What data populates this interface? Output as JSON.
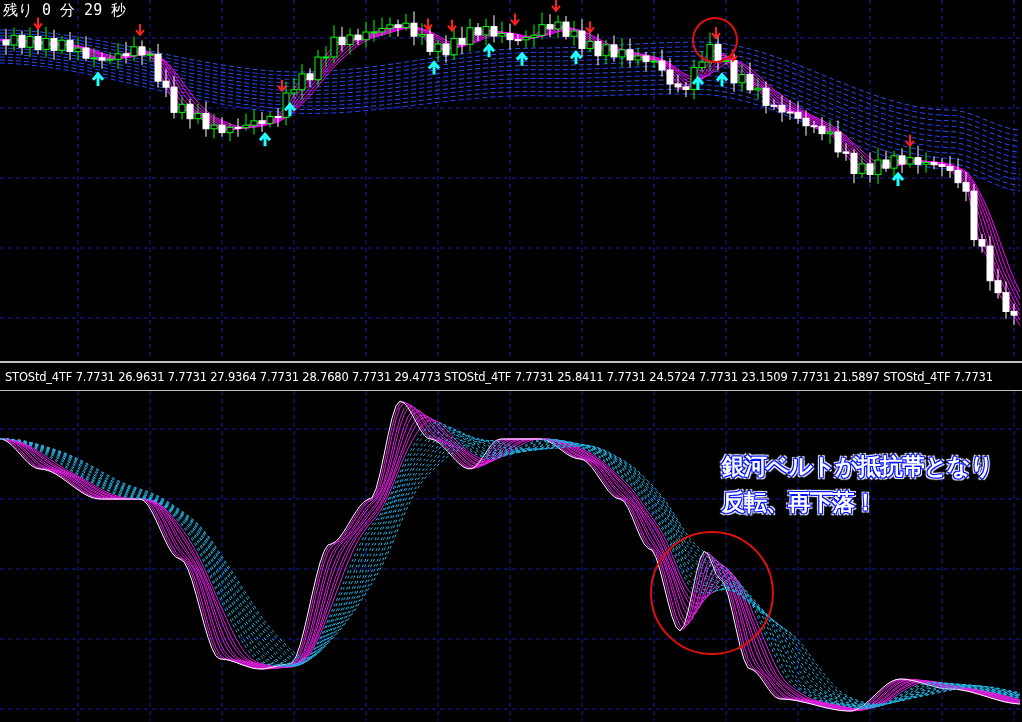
{
  "price_pane": {
    "timer": "残り 0 分 29 秒"
  },
  "indicator_pane": {
    "legend": "STOStd_4TF 7.7731 26.9631 7.7731 27.9364 7.7731 28.7680 7.7731 29.4773  STOStd_4TF 7.7731 25.8411 7.7731 24.5724 7.7731 23.1509 7.7731 21.5897  STOStd_4TF 7.7731",
    "annotation": [
      "銀河ベルトが抵抗帯となり",
      "反転、再下落！"
    ]
  }
}
